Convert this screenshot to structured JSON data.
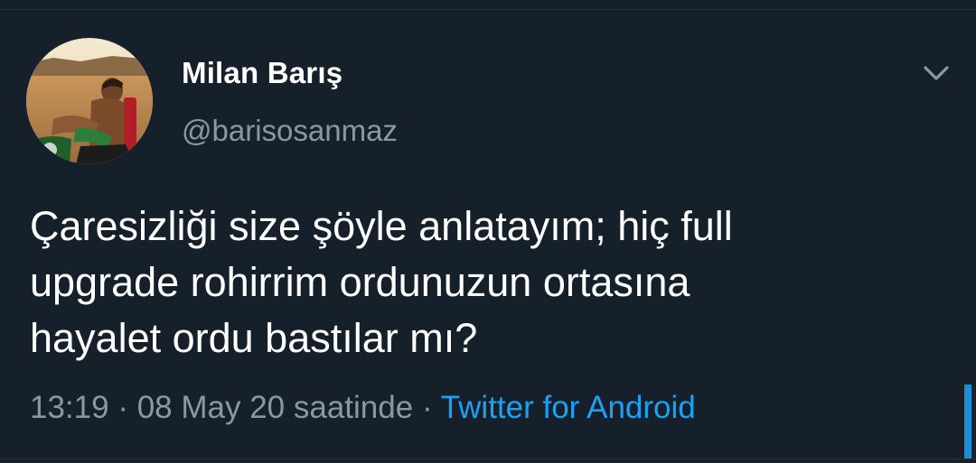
{
  "tweet": {
    "author": {
      "display_name": "Milan Barış",
      "handle": "@barisosanmaz",
      "avatar_icon": "profile-photo"
    },
    "menu_icon": "chevron-down-icon",
    "text": "Çaresizliği size şöyle anlatayım; hiç full\nupgrade rohirrim ordunuzun ortasına\nhayalet ordu bastılar mı?",
    "meta": {
      "time": "13:19",
      "separator": "·",
      "date": "08 May 20 saatinde",
      "source": "Twitter for Android"
    }
  },
  "colors": {
    "background": "#15202b",
    "primary_text": "#ffffff",
    "secondary_text": "#8899a6",
    "accent": "#1da1f2"
  }
}
